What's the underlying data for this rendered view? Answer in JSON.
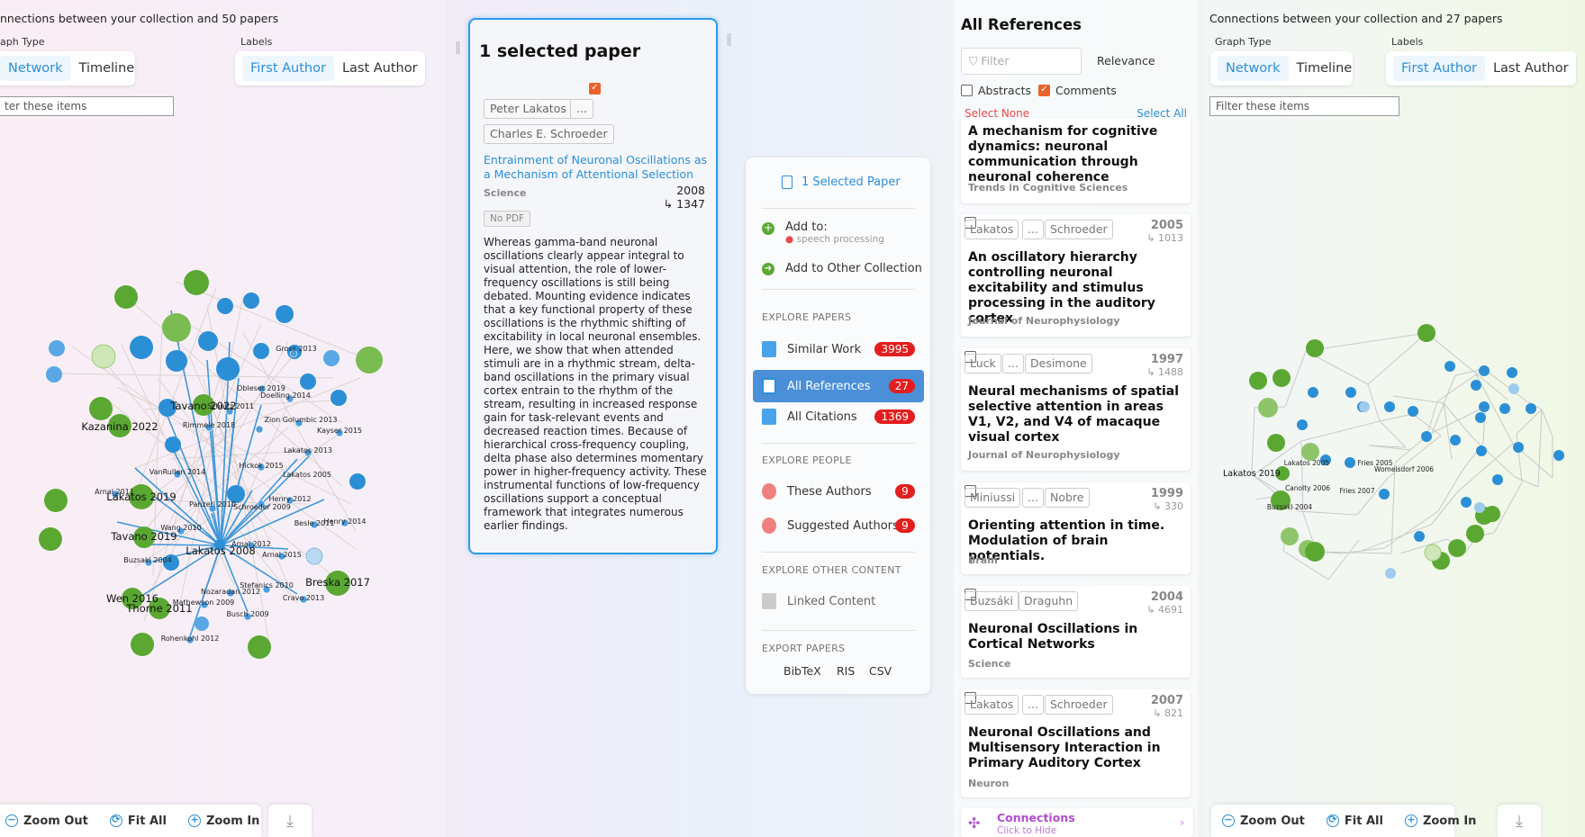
{
  "left_graph": {
    "title": "nnections between your collection and 50 papers",
    "graph_type_label": "aph Type",
    "graph_type_options": [
      "Network",
      "Timeline"
    ],
    "labels_label": "Labels",
    "label_options": [
      "First Author",
      "Last Author"
    ],
    "filter_placeholder": "ter these items",
    "node_labels": [
      "Gross 2013",
      "Obleser 2019",
      "Doelling 2014",
      "Tavano 2022",
      "Schultz 2011",
      "Kazanina 2022",
      "Rimmele 2018",
      "Zion Golumbic 2013",
      "Kayser 2015",
      "Lakatos 2013",
      "Lakatos 2005",
      "VanRullen 2014",
      "Hickok 2015",
      "Arnal 2011",
      "Lakatos 2019",
      "Panzeri 2010",
      "Henry 2012",
      "Schroeder 2009",
      "Besle 2011",
      "Henry 2014",
      "Wang 2010",
      "Arnal 2012",
      "Tavano 2019",
      "Lakatos 2008",
      "Arnal 2015",
      "Buzsaki 2004",
      "Breska 2017",
      "Stefanics 2010",
      "Wen 2016",
      "Thorne 2011",
      "Mathewson 2009",
      "Nozaradan 2012",
      "Cravo 2013",
      "Busch 2009",
      "Rohenkohl 2012"
    ],
    "toolbar": [
      "Zoom Out",
      "Fit All",
      "Zoom In"
    ]
  },
  "selected_paper": {
    "heading": "1 selected paper",
    "authors": [
      "Peter Lakatos",
      "...",
      "Charles E. Schroeder"
    ],
    "title": "Entrainment of Neuronal Oscillations as a Mechanism of Attentional Selection",
    "venue": "Science",
    "year": "2008",
    "citations": "↳ 1347",
    "pdf": "No PDF",
    "abstract": "Whereas gamma-band neuronal oscillations clearly appear integral to visual attention, the role of lower-frequency oscillations is still being debated. Mounting evidence indicates that a key functional property of these oscillations is the rhythmic shifting of excitability in local neuronal ensembles. Here, we show that when attended stimuli are in a rhythmic stream, delta-band oscillations in the primary visual cortex entrain to the rhythm of the stream, resulting in increased response gain for task-relevant events and decreased reaction times. Because of hierarchical cross-frequency coupling, delta phase also determines momentary power in higher-frequency activity. These instrumental functions of low-frequency oscillations support a conceptual framework that integrates numerous earlier findings."
  },
  "actions": {
    "selected": "1 Selected Paper",
    "add_to": "Add to:",
    "collection": "speech processing",
    "add_other": "Add to Other Collection",
    "explore_papers": "EXPLORE PAPERS",
    "similar": {
      "label": "Similar Work",
      "count": "3995"
    },
    "references": {
      "label": "All References",
      "count": "27"
    },
    "citations": {
      "label": "All Citations",
      "count": "1369"
    },
    "explore_people": "EXPLORE PEOPLE",
    "these_authors": {
      "label": "These Authors",
      "count": "9"
    },
    "suggested_authors": {
      "label": "Suggested Authors",
      "count": "9"
    },
    "explore_other": "EXPLORE OTHER CONTENT",
    "linked": "Linked Content",
    "export": "EXPORT PAPERS",
    "formats": [
      "BibTeX",
      "RIS",
      "CSV"
    ]
  },
  "references": {
    "heading": "All References",
    "filter_placeholder": "Filter",
    "sort": "Relevance",
    "abstracts": "Abstracts",
    "comments": "Comments",
    "select_none": "Select None",
    "select_all": "Select All",
    "items": [
      {
        "title": "A mechanism for cognitive dynamics: neuronal communication through neuronal coherence",
        "venue": "Trends in Cognitive Sciences"
      },
      {
        "a1": "Lakatos",
        "mid": "...",
        "a2": "Schroeder",
        "year": "2005",
        "cit": "↳ 1013",
        "title": "An oscillatory hierarchy controlling neuronal excitability and stimulus processing in the auditory cortex",
        "venue": "Journal of Neurophysiology"
      },
      {
        "a1": "Luck",
        "mid": "...",
        "a2": "Desimone",
        "year": "1997",
        "cit": "↳ 1488",
        "title": "Neural mechanisms of spatial selective attention in areas V1, V2, and V4 of macaque visual cortex",
        "venue": "Journal of Neurophysiology"
      },
      {
        "a1": "Miniussi",
        "mid": "...",
        "a2": "Nobre",
        "year": "1999",
        "cit": "↳ 330",
        "title": "Orienting attention in time. Modulation of brain potentials.",
        "venue": "Brain"
      },
      {
        "a1": "Buzsáki",
        "a2": "Draguhn",
        "year": "2004",
        "cit": "↳ 4691",
        "title": "Neuronal Oscillations in Cortical Networks",
        "venue": "Science"
      },
      {
        "a1": "Lakatos",
        "mid": "...",
        "a2": "Schroeder",
        "year": "2007",
        "cit": "↳ 821",
        "title": "Neuronal Oscillations and Multisensory Interaction in Primary Auditory Cortex",
        "venue": "Neuron"
      }
    ],
    "connections": "Connections",
    "connections_sub": "Click to Hide"
  },
  "right_graph": {
    "title": "Connections between your collection and 27 papers",
    "graph_type_label": "Graph Type",
    "graph_type_options": [
      "Network",
      "Timeline"
    ],
    "labels_label": "Labels",
    "label_options": [
      "First Author",
      "Last Author"
    ],
    "filter_placeholder": "Filter these items",
    "node_labels": [
      "Lakatos 2019",
      "Lakatos 2005",
      "Lakatos 2008",
      "Buzsaki 2004",
      "Fries 2005",
      "Womelsdorf 2006",
      "Canolty 2006",
      "Fries 2007"
    ],
    "toolbar": [
      "Zoom Out",
      "Fit All",
      "Zoom In"
    ]
  },
  "colors": {
    "accent": "#2b8fd6",
    "green": "#5aa832",
    "badge": "#e41e1e",
    "selected": "#e8622a"
  }
}
